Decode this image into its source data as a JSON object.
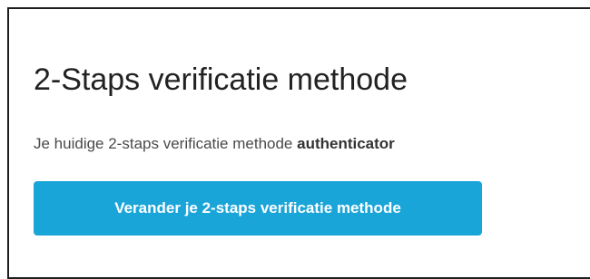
{
  "section": {
    "title": "2-Staps verificatie methode",
    "description_prefix": "Je huidige 2-staps verificatie methode ",
    "current_method": "authenticator",
    "change_button_label": "Verander je 2-staps verificatie methode"
  },
  "colors": {
    "button_background": "#1aa5d9",
    "button_text": "#ffffff",
    "title_text": "#222222",
    "body_text": "#4a4a4a",
    "border": "#1e1e1e"
  }
}
